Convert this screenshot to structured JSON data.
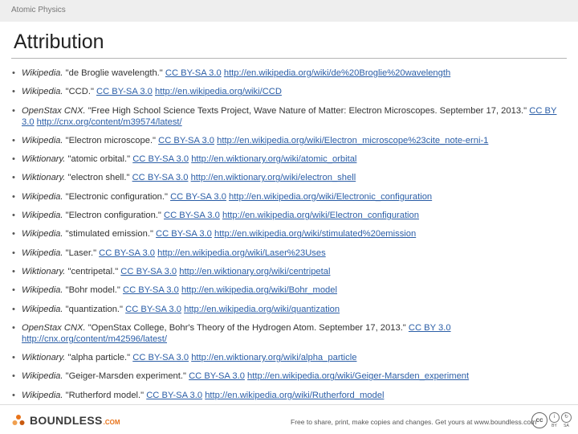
{
  "header": {
    "breadcrumb": "Atomic Physics",
    "title": "Attribution"
  },
  "items": [
    {
      "source": "Wikipedia.",
      "text": " \"de Broglie wavelength.\" ",
      "license": "CC BY-SA 3.0",
      "url": "http://en.wikipedia.org/wiki/de%20Broglie%20wavelength"
    },
    {
      "source": "Wikipedia.",
      "text": " \"CCD.\" ",
      "license": "CC BY-SA 3.0",
      "url": "http://en.wikipedia.org/wiki/CCD"
    },
    {
      "source": "OpenStax CNX.",
      "text": " \"Free High School Science Texts Project, Wave Nature of Matter: Electron Microscopes. September 17, 2013.\" ",
      "license": "CC BY 3.0",
      "url": "http://cnx.org/content/m39574/latest/"
    },
    {
      "source": "Wikipedia.",
      "text": " \"Electron microscope.\" ",
      "license": "CC BY-SA 3.0",
      "url": "http://en.wikipedia.org/wiki/Electron_microscope%23cite_note-erni-1"
    },
    {
      "source": "Wiktionary.",
      "text": " \"atomic orbital.\" ",
      "license": "CC BY-SA 3.0",
      "url": "http://en.wiktionary.org/wiki/atomic_orbital"
    },
    {
      "source": "Wiktionary.",
      "text": " \"electron shell.\" ",
      "license": "CC BY-SA 3.0",
      "url": "http://en.wiktionary.org/wiki/electron_shell"
    },
    {
      "source": "Wikipedia.",
      "text": " \"Electronic configuration.\" ",
      "license": "CC BY-SA 3.0",
      "url": "http://en.wikipedia.org/wiki/Electronic_configuration"
    },
    {
      "source": "Wikipedia.",
      "text": " \"Electron configuration.\" ",
      "license": "CC BY-SA 3.0",
      "url": "http://en.wikipedia.org/wiki/Electron_configuration"
    },
    {
      "source": "Wikipedia.",
      "text": " \"stimulated emission.\" ",
      "license": "CC BY-SA 3.0",
      "url": "http://en.wikipedia.org/wiki/stimulated%20emission"
    },
    {
      "source": "Wikipedia.",
      "text": " \"Laser.\" ",
      "license": "CC BY-SA 3.0",
      "url": "http://en.wikipedia.org/wiki/Laser%23Uses"
    },
    {
      "source": "Wiktionary.",
      "text": " \"centripetal.\" ",
      "license": "CC BY-SA 3.0",
      "url": "http://en.wiktionary.org/wiki/centripetal"
    },
    {
      "source": "Wikipedia.",
      "text": " \"Bohr model.\" ",
      "license": "CC BY-SA 3.0",
      "url": "http://en.wikipedia.org/wiki/Bohr_model"
    },
    {
      "source": "Wikipedia.",
      "text": " \"quantization.\" ",
      "license": "CC BY-SA 3.0",
      "url": "http://en.wikipedia.org/wiki/quantization"
    },
    {
      "source": "OpenStax CNX.",
      "text": " \"OpenStax College, Bohr's Theory of the Hydrogen Atom. September 17, 2013.\" ",
      "license": "CC BY 3.0",
      "url": "http://cnx.org/content/m42596/latest/"
    },
    {
      "source": "Wiktionary.",
      "text": " \"alpha particle.\" ",
      "license": "CC BY-SA 3.0",
      "url": "http://en.wiktionary.org/wiki/alpha_particle"
    },
    {
      "source": "Wikipedia.",
      "text": " \"Geiger-Marsden experiment.\" ",
      "license": "CC BY-SA 3.0",
      "url": "http://en.wikipedia.org/wiki/Geiger-Marsden_experiment"
    },
    {
      "source": "Wikipedia.",
      "text": " \"Rutherford model.\" ",
      "license": "CC BY-SA 3.0",
      "url": "http://en.wikipedia.org/wiki/Rutherford_model"
    }
  ],
  "footer": {
    "brand": "BOUNDLESS",
    "brand_suffix": ".COM",
    "tagline": "Free to share, print, make copies and changes. Get yours at www.boundless.com",
    "cc_badge": "cc",
    "by_badge": "i",
    "by_label": "BY",
    "sa_label": "SA"
  },
  "colors": {
    "link": "#2b5ea7",
    "accent": "#e8731a",
    "topbar": "#eeeeee"
  }
}
